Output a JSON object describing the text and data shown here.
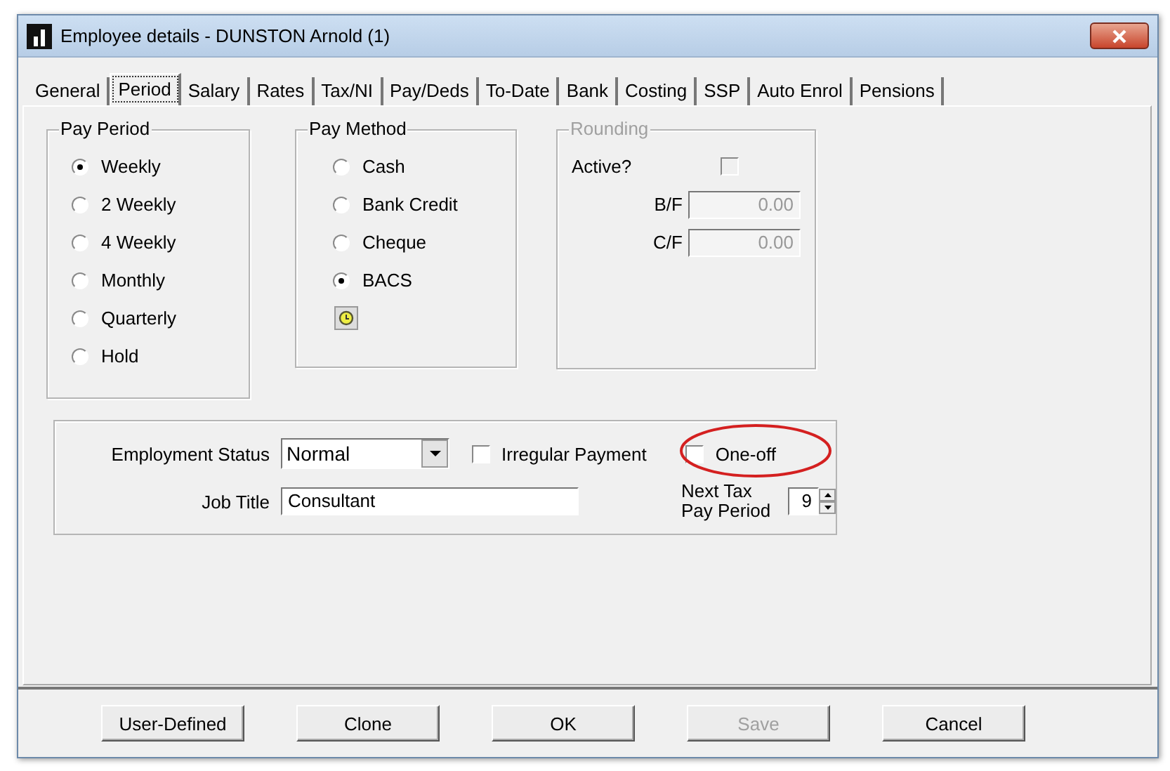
{
  "window": {
    "title": "Employee details - DUNSTON Arnold (1)"
  },
  "tabs": [
    {
      "label": "General",
      "selected": false
    },
    {
      "label": "Period",
      "selected": true
    },
    {
      "label": "Salary",
      "selected": false
    },
    {
      "label": "Rates",
      "selected": false
    },
    {
      "label": "Tax/NI",
      "selected": false
    },
    {
      "label": "Pay/Deds",
      "selected": false
    },
    {
      "label": "To-Date",
      "selected": false
    },
    {
      "label": "Bank",
      "selected": false
    },
    {
      "label": "Costing",
      "selected": false
    },
    {
      "label": "SSP",
      "selected": false
    },
    {
      "label": "Auto Enrol",
      "selected": false
    },
    {
      "label": "Pensions",
      "selected": false
    }
  ],
  "pay_period": {
    "title": "Pay Period",
    "options": [
      {
        "label": "Weekly",
        "selected": true
      },
      {
        "label": "2 Weekly",
        "selected": false
      },
      {
        "label": "4 Weekly",
        "selected": false
      },
      {
        "label": "Monthly",
        "selected": false
      },
      {
        "label": "Quarterly",
        "selected": false
      },
      {
        "label": "Hold",
        "selected": false
      }
    ]
  },
  "pay_method": {
    "title": "Pay Method",
    "options": [
      {
        "label": "Cash",
        "selected": false
      },
      {
        "label": "Bank Credit",
        "selected": false
      },
      {
        "label": "Cheque",
        "selected": false
      },
      {
        "label": "BACS",
        "selected": true
      }
    ]
  },
  "rounding": {
    "title": "Rounding",
    "disabled": true,
    "active_label": "Active?",
    "active_checked": false,
    "fields": [
      {
        "label": "B/F",
        "value": "0.00"
      },
      {
        "label": "C/F",
        "value": "0.00"
      }
    ]
  },
  "employment": {
    "status_label": "Employment Status",
    "status_value": "Normal",
    "irregular": {
      "label": "Irregular Payment",
      "checked": false
    },
    "one_off": {
      "label": "One-off",
      "checked": false
    },
    "job_title_label": "Job Title",
    "job_title_value": "Consultant",
    "next_tax_label": "Next Tax Pay Period",
    "next_tax_value": "9"
  },
  "buttons": [
    {
      "label": "User-Defined",
      "disabled": false
    },
    {
      "label": "Clone",
      "disabled": false
    },
    {
      "label": "OK",
      "disabled": false
    },
    {
      "label": "Save",
      "disabled": true
    },
    {
      "label": "Cancel",
      "disabled": false
    }
  ]
}
